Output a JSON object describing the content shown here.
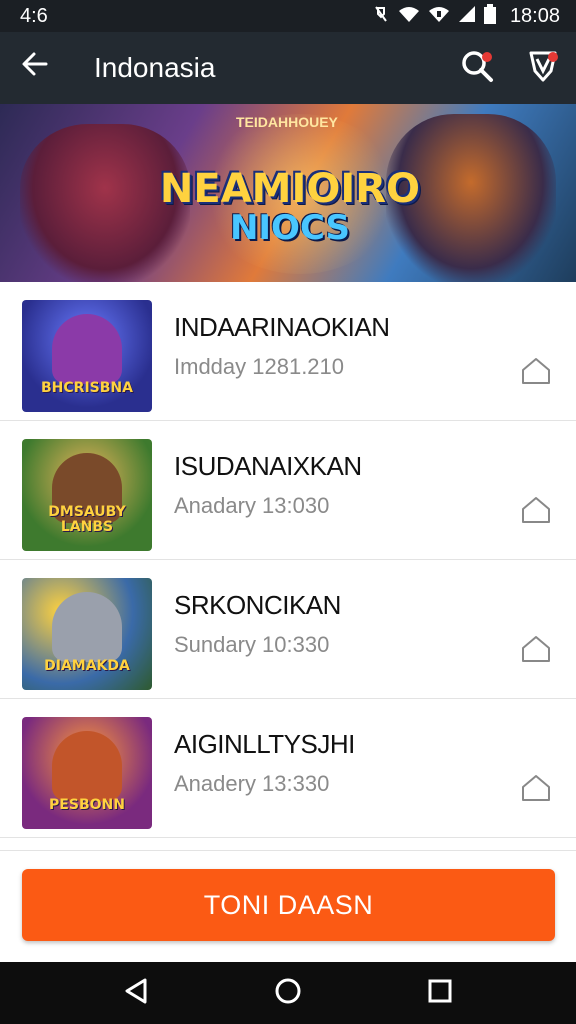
{
  "status_bar": {
    "time_left": "4:6",
    "time_right": "18:08",
    "icons": [
      "notification-mute-icon",
      "wifi-icon",
      "wifi-alt-icon",
      "signal-icon",
      "battery-icon"
    ]
  },
  "app_bar": {
    "title": "Indonasia",
    "icons": [
      "back-arrow-icon",
      "search-icon",
      "shield-icon"
    ]
  },
  "banner": {
    "logo_top": "NEAMIOIRO",
    "logo_bottom": "NIOCS",
    "small_caption": "TEIDAHHOUEY"
  },
  "items": [
    {
      "title": "INDAARINAOKIAN",
      "subtitle": "Imdday 1281.210",
      "thumb_caption": "BHCRISBNA",
      "thumb_bg": "#2a2f8f",
      "icon": "home-outline-icon"
    },
    {
      "title": "ISUDANAIXKAN",
      "subtitle": "Anadary    13:030",
      "thumb_caption": "DMSAUBY LANBS",
      "thumb_bg": "#3e7a2e",
      "icon": "home-outline-icon"
    },
    {
      "title": "SRKONCIKAN",
      "subtitle": "Sundary    10:330",
      "thumb_caption": "DIAMAKDA",
      "thumb_bg": "#3a6aa8",
      "icon": "home-outline-icon"
    },
    {
      "title": "AIGINLLTYSJHI",
      "subtitle": "Anadery    13:330",
      "thumb_caption": "PESBONN",
      "thumb_bg": "#7a2a7e",
      "icon": "home-outline-icon"
    }
  ],
  "primary_button": {
    "label": "TONI DAASN"
  },
  "nav_bar": {
    "icons": [
      "back-triangle-icon",
      "home-circle-icon",
      "recents-square-icon"
    ]
  },
  "colors": {
    "accent": "#fb5a14",
    "app_bar": "#232a31",
    "status_bar": "#1b1f24"
  }
}
